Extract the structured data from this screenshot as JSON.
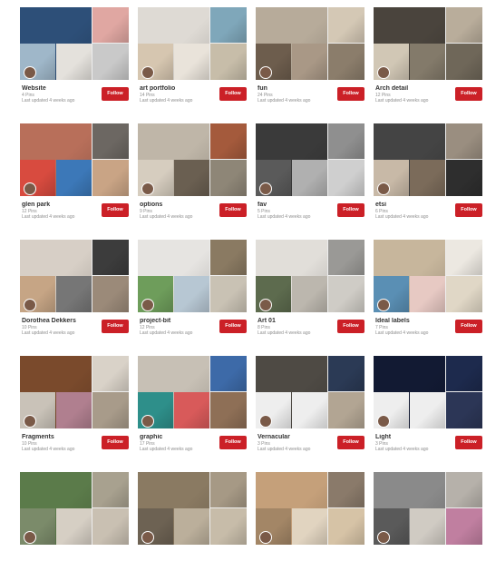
{
  "boards": [
    {
      "title": "Website",
      "pins": "4 Pins",
      "updated": "Last updated 4 weeks ago",
      "follow_label": "Follow",
      "colors": [
        "#2d4f78",
        "#e0a7a2",
        "#c9c9c9",
        "#9fb7c9",
        "#e4e1dc"
      ]
    },
    {
      "title": "art portfolio",
      "pins": "14 Pins",
      "updated": "Last updated 4 weeks ago",
      "follow_label": "Follow",
      "colors": [
        "#dedad4",
        "#7fa7ba",
        "#c7bda9",
        "#d6c6b0",
        "#e9e3da"
      ]
    },
    {
      "title": "fun",
      "pins": "24 Pins",
      "updated": "Last updated 4 weeks ago",
      "follow_label": "Follow",
      "colors": [
        "#b7ab9a",
        "#d4c8b5",
        "#8b7d6b",
        "#6d5d4d",
        "#a99886"
      ]
    },
    {
      "title": "Arch detail",
      "pins": "12 Pins",
      "updated": "Last updated 4 weeks ago",
      "follow_label": "Follow",
      "colors": [
        "#4a443d",
        "#b9ad9b",
        "#6f6759",
        "#d1c7b5",
        "#837a6a"
      ]
    },
    {
      "title": "glen park",
      "pins": "12 Pins",
      "updated": "Last updated 4 weeks ago",
      "follow_label": "Follow",
      "colors": [
        "#b86f5a",
        "#6c6762",
        "#c9a485",
        "#d84b3f",
        "#3c78b8"
      ]
    },
    {
      "title": "options",
      "pins": "9 Pins",
      "updated": "Last updated 4 weeks ago",
      "follow_label": "Follow",
      "colors": [
        "#bfb6a8",
        "#a45a3c",
        "#8e8677",
        "#d6cdbf",
        "#6a5f51"
      ]
    },
    {
      "title": "fav",
      "pins": "5 Pins",
      "updated": "Last updated 4 weeks ago",
      "follow_label": "Follow",
      "colors": [
        "#3a3a3a",
        "#8f8f8f",
        "#cfcfcf",
        "#5a5a5a",
        "#b0b0b0"
      ]
    },
    {
      "title": "etsi",
      "pins": "6 Pins",
      "updated": "Last updated 4 weeks ago",
      "follow_label": "Follow",
      "colors": [
        "#444444",
        "#9a8e80",
        "#2e2e2e",
        "#c8b9a7",
        "#7b6b5a"
      ]
    },
    {
      "title": "Dorothea Dekkers",
      "pins": "10 Pins",
      "updated": "Last updated 4 weeks ago",
      "follow_label": "Follow",
      "colors": [
        "#d7cfc6",
        "#3c3c3c",
        "#9b8a79",
        "#c6a585",
        "#767676"
      ]
    },
    {
      "title": "project-bit",
      "pins": "12 Pins",
      "updated": "Last updated 4 weeks ago",
      "follow_label": "Follow",
      "colors": [
        "#e6e4e1",
        "#8a7a62",
        "#c9c2b4",
        "#6e9d5b",
        "#b7c7d3"
      ]
    },
    {
      "title": "Art 01",
      "pins": "8 Pins",
      "updated": "Last updated 4 weeks ago",
      "follow_label": "Follow",
      "colors": [
        "#e1ded9",
        "#9a9996",
        "#cfccc6",
        "#5d6b4e",
        "#bcb7ae"
      ]
    },
    {
      "title": "Ideal labels",
      "pins": "7 Pins",
      "updated": "Last updated 4 weeks ago",
      "follow_label": "Follow",
      "colors": [
        "#c7b69c",
        "#ece8e1",
        "#e0d7c6",
        "#5a8fb4",
        "#e7c9c3"
      ]
    },
    {
      "title": "Fragments",
      "pins": "10 Pins",
      "updated": "Last updated 4 weeks ago",
      "follow_label": "Follow",
      "colors": [
        "#7a4a2c",
        "#d9d2c8",
        "#a89b8a",
        "#c9c2b8",
        "#b07f8f"
      ]
    },
    {
      "title": "graphic",
      "pins": "17 Pins",
      "updated": "Last updated 4 weeks ago",
      "follow_label": "Follow",
      "colors": [
        "#c7c0b5",
        "#3d6aa8",
        "#8e6f56",
        "#2e8f8a",
        "#d85a5a"
      ]
    },
    {
      "title": "Vernacular",
      "pins": "3 Pins",
      "updated": "Last updated 4 weeks ago",
      "follow_label": "Follow",
      "colors": [
        "#4e4a44",
        "#2b3a55",
        "#b2a593",
        "#eeeeee",
        "#eeeeee"
      ]
    },
    {
      "title": "Light",
      "pins": "3 Pins",
      "updated": "Last updated 4 weeks ago",
      "follow_label": "Follow",
      "colors": [
        "#121a33",
        "#1d2a4d",
        "#2c3656",
        "#eeeeee",
        "#eeeeee"
      ]
    },
    {
      "title": "",
      "pins": "",
      "updated": "",
      "follow_label": "",
      "colors": [
        "#5b7b4a",
        "#a8a18f",
        "#c9c0b2",
        "#7b8b6a",
        "#d6cfc4"
      ]
    },
    {
      "title": "",
      "pins": "",
      "updated": "",
      "follow_label": "",
      "colors": [
        "#8a7a62",
        "#a69985",
        "#c7bca9",
        "#6d6253",
        "#bbaf9b"
      ]
    },
    {
      "title": "",
      "pins": "",
      "updated": "",
      "follow_label": "",
      "colors": [
        "#c5a07a",
        "#8a7a6a",
        "#d6c3a6",
        "#a38666",
        "#e1d4c0"
      ]
    },
    {
      "title": "",
      "pins": "",
      "updated": "",
      "follow_label": "",
      "colors": [
        "#8a8a8a",
        "#b6b1aa",
        "#c07fa0",
        "#5a5a5a",
        "#d0cbc3"
      ]
    }
  ]
}
